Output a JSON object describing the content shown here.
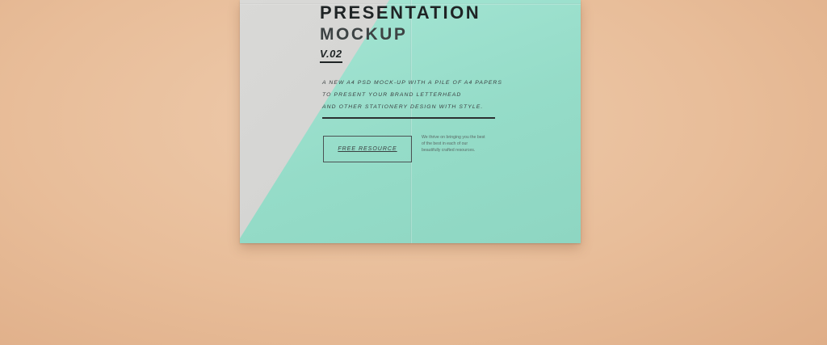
{
  "mockup": {
    "title": "PRESENTATION",
    "subtitle": "MOCKUP",
    "version": "V.02",
    "description": [
      "A NEW A4 PSD MOCK-UP WITH A PILE OF A4 PAPERS",
      "TO PRESENT YOUR BRAND LETTERHEAD",
      "AND  OTHER STATIONERY DESIGN WITH STYLE."
    ],
    "button_label": "FREE RESOURCE",
    "note": "We thrive on bringing you the best of the best in each of our beautifully crafted resources."
  },
  "colors": {
    "background": "#e8bd99",
    "paper_gray": "#d3d3d1",
    "paper_mint": "#9de1cf",
    "ink": "#1f2425"
  }
}
